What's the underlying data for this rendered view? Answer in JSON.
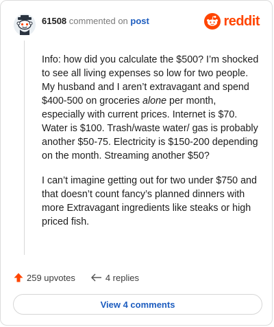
{
  "header": {
    "username": "61508",
    "commented_text": "commented on",
    "post_link": "post",
    "brand": "reddit",
    "avatar_icon": "reddit-snoo-avatar-icon",
    "brand_icon": "reddit-alien-logo-icon"
  },
  "comment": {
    "paragraph1_part1": "Info: how did you calculate the $500? I’m shocked to see all living expenses so low for two people. My husband and I aren’t extravagant and spend $400-500 on groceries ",
    "paragraph1_emphasis": "alone",
    "paragraph1_part2": " per month, especially with current prices. Internet is $70. Water is $100. Trash/waste water/ gas is probably another $50-75. Electricity is $150-200 depending on the month. Streaming another $50?",
    "paragraph2": "I can’t imagine getting out for two under $750 and that doesn’t count fancy’s planned dinners with more Extravagant ingredients like steaks or high priced fish."
  },
  "actions": {
    "upvotes": "259 upvotes",
    "replies": "4 replies",
    "upvote_icon": "upvote-arrow-icon",
    "reply_icon": "reply-arrow-icon"
  },
  "view_comments_label": "View 4 comments",
  "colors": {
    "brand": "#ff4500",
    "link": "#1c5cbf"
  }
}
